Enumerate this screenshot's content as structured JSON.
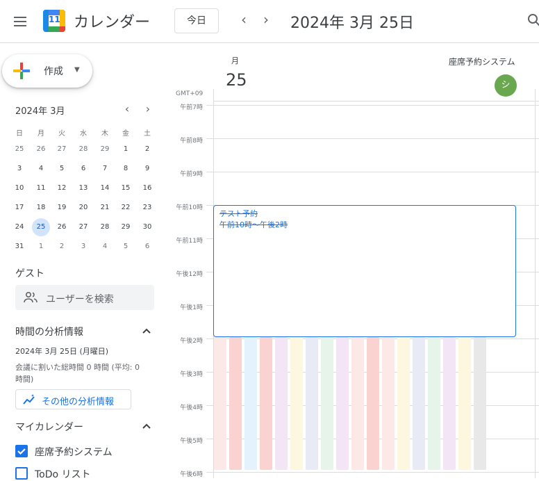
{
  "header": {
    "app_title": "カレンダー",
    "logo_number": "11",
    "today_label": "今日",
    "prev_label": "‹",
    "next_label": "›",
    "date_title": "2024年 3月 25日"
  },
  "sidebar": {
    "create_label": "作成",
    "mini_calendar": {
      "title": "2024年 3月",
      "weekdays": [
        "日",
        "月",
        "火",
        "水",
        "木",
        "金",
        "土"
      ],
      "weeks": [
        [
          "25",
          "26",
          "27",
          "28",
          "29",
          "1",
          "2"
        ],
        [
          "3",
          "4",
          "5",
          "6",
          "7",
          "8",
          "9"
        ],
        [
          "10",
          "11",
          "12",
          "13",
          "14",
          "15",
          "16"
        ],
        [
          "17",
          "18",
          "19",
          "20",
          "21",
          "22",
          "23"
        ],
        [
          "24",
          "25",
          "26",
          "27",
          "28",
          "29",
          "30"
        ],
        [
          "31",
          "1",
          "2",
          "3",
          "4",
          "5",
          "6"
        ]
      ],
      "selected": "25"
    },
    "guest_heading": "ゲスト",
    "search_users_placeholder": "ユーザーを検索",
    "analytics_heading": "時間の分析情報",
    "analytics_date": "2024年 3月 25日 (月曜日)",
    "analytics_text_1": "会議に割いた総時間 0 時間 (平均: 0",
    "analytics_text_2": "時間)",
    "more_analytics_label": "その他の分析情報",
    "my_calendars_heading": "マイカレンダー",
    "calendars": [
      {
        "label": "座席予約システム",
        "checked": true
      },
      {
        "label": "ToDo リスト",
        "checked": false
      }
    ]
  },
  "main": {
    "day_name": "月",
    "day_number": "25",
    "resource_name": "座席予約システム",
    "avatar_letter": "シ",
    "timezone": "GMT+09",
    "hours": [
      "午前7時",
      "午前8時",
      "午前9時",
      "午前10時",
      "午前11時",
      "午後12時",
      "午後1時",
      "午後2時",
      "午後3時",
      "午後4時",
      "午後5時",
      "午後6時"
    ],
    "event": {
      "title": "テスト予約",
      "time": "午前10時～午後2時"
    },
    "stripe_colors": [
      "#fce8e6",
      "#fad2cf",
      "#e3f2fd",
      "#fad2cf",
      "#f3e5f5",
      "#fef7e0",
      "#e8eaf6",
      "#e6f4ea",
      "#f3e5f5",
      "#fce8e6",
      "#fad2cf",
      "#fce8e6",
      "#fef7e0",
      "#e8eaf6",
      "#e6f4ea",
      "#f3e5f5",
      "#fef7e0",
      "#e8e8e8"
    ]
  }
}
